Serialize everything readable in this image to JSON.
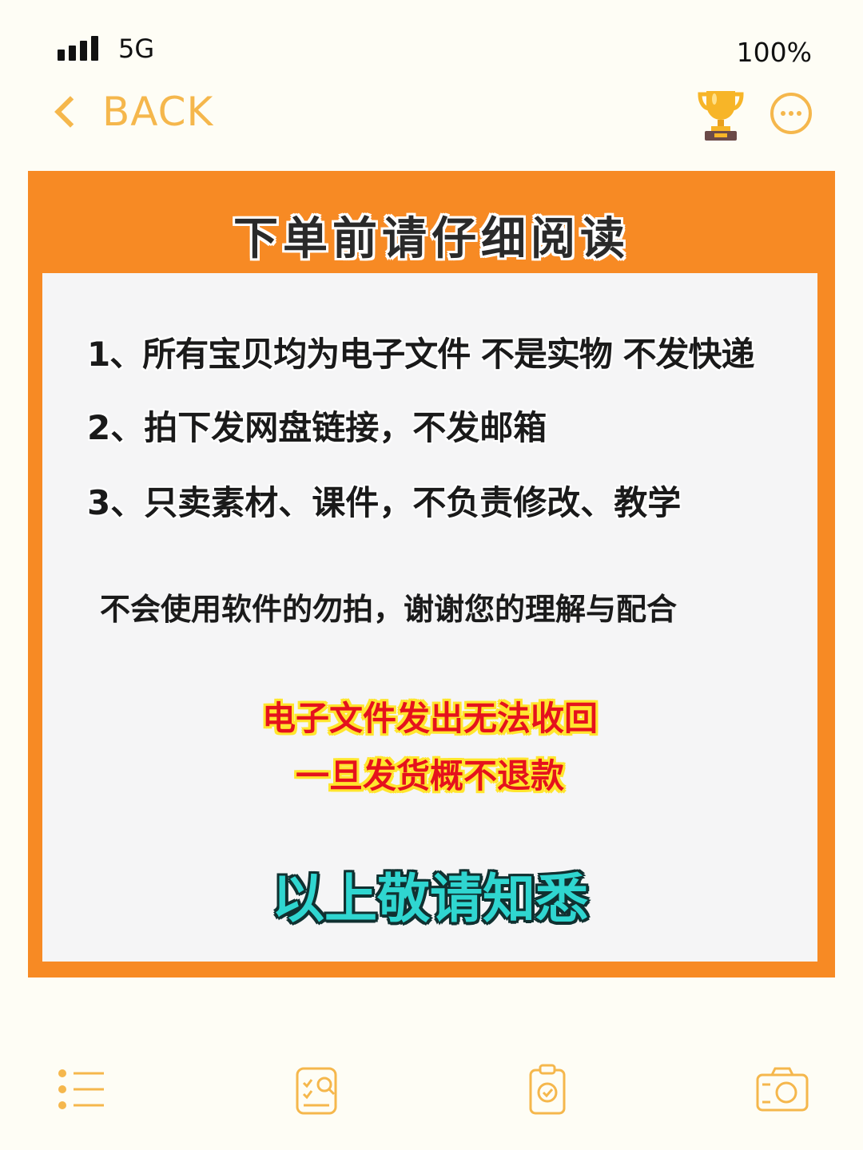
{
  "status_bar": {
    "network": "5G",
    "battery": "100%"
  },
  "nav": {
    "back_label": "BACK",
    "icons": [
      "chevron-left-icon",
      "trophy-icon",
      "more-icon"
    ]
  },
  "notice": {
    "title": "下单前请仔细阅读",
    "rules": [
      "1、所有宝贝均为电子文件 不是实物 不发快递",
      "2、拍下发网盘链接，不发邮箱",
      "3、只卖素材、课件，不负责修改、教学"
    ],
    "note": "不会使用软件的勿拍，谢谢您的理解与配合",
    "warnings": [
      "电子文件发出无法收回",
      "一旦发货概不退款"
    ],
    "final": "以上敬请知悉"
  },
  "tabbar": {
    "icons": [
      "list-icon",
      "search-document-icon",
      "clipboard-check-icon",
      "camera-icon"
    ]
  },
  "colors": {
    "accent": "#F5B74C",
    "card_border": "#F78A24",
    "warning_text": "#E5121D",
    "warning_outline": "#FFE62E",
    "final_text": "#2FD6D0"
  }
}
